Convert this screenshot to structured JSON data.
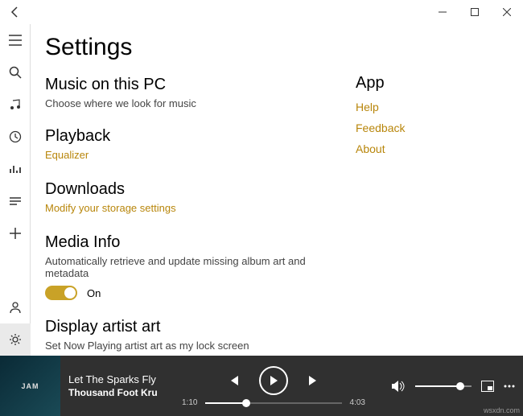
{
  "page_title": "Settings",
  "sections": {
    "music": {
      "title": "Music on this PC",
      "desc": "Choose where we look for music"
    },
    "playback": {
      "title": "Playback",
      "link": "Equalizer"
    },
    "downloads": {
      "title": "Downloads",
      "link": "Modify your storage settings"
    },
    "media_info": {
      "title": "Media Info",
      "desc": "Automatically retrieve and update missing album art and metadata",
      "toggle": "On"
    },
    "artist_art": {
      "title": "Display artist art",
      "desc": "Set Now Playing artist art as my lock screen"
    }
  },
  "app": {
    "title": "App",
    "links": {
      "help": "Help",
      "feedback": "Feedback",
      "about": "About"
    }
  },
  "player": {
    "album_label": "JAM",
    "track": "Let The Sparks Fly",
    "artist": "Thousand Foot Kru",
    "elapsed": "1:10",
    "total": "4:03"
  },
  "watermark": "wsxdn.com"
}
